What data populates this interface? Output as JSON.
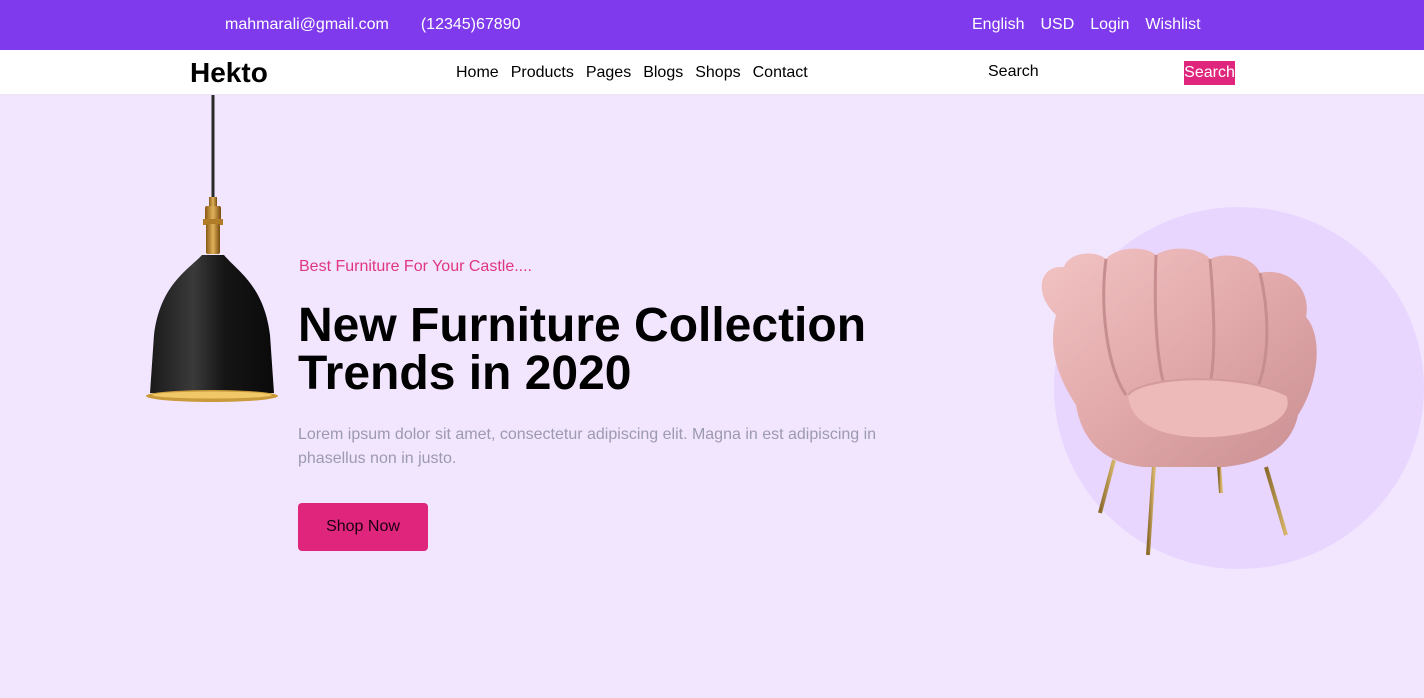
{
  "topbar": {
    "email": "mahmarali@gmail.com",
    "phone": "(12345)67890",
    "language": "English",
    "currency": "USD",
    "login": "Login",
    "wishlist": "Wishlist"
  },
  "navbar": {
    "logo": "Hekto",
    "links": [
      "Home",
      "Products",
      "Pages",
      "Blogs",
      "Shops",
      "Contact"
    ],
    "search_placeholder": "Search",
    "search_button": "Search"
  },
  "hero": {
    "eyebrow": "Best Furniture For Your Castle....",
    "title": "New Furniture Collection Trends in 2020",
    "description": "Lorem ipsum dolor sit amet, consectetur adipiscing elit. Magna in est adipiscing in phasellus non in justo.",
    "cta": "Shop Now"
  },
  "colors": {
    "topbar_bg": "#7E3AEC",
    "hero_bg": "#F2E6FF",
    "accent_pink": "#E0257C",
    "circle": "#E8D6FF"
  },
  "images": {
    "lamp": "pendant-lamp-illustration",
    "chair": "pink-armchair-illustration"
  }
}
